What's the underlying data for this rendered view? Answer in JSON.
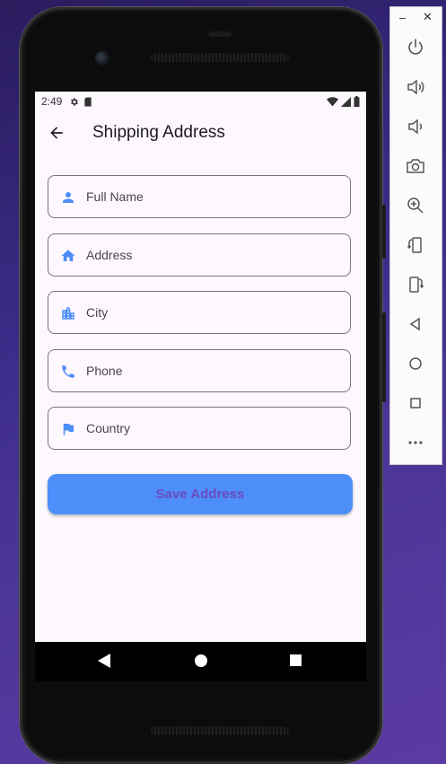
{
  "status_bar": {
    "time": "2:49"
  },
  "app_bar": {
    "title": "Shipping Address"
  },
  "form": {
    "fields": [
      {
        "placeholder": "Full Name",
        "icon": "person-icon"
      },
      {
        "placeholder": "Address",
        "icon": "home-icon"
      },
      {
        "placeholder": "City",
        "icon": "city-icon"
      },
      {
        "placeholder": "Phone",
        "icon": "phone-icon"
      },
      {
        "placeholder": "Country",
        "icon": "flag-icon"
      }
    ],
    "save_label": "Save Address"
  },
  "colors": {
    "accent": "#4e8ef8",
    "button_text": "#6a4cbf",
    "screen_bg": "#fdf7fe",
    "icon": "#4e8ef8"
  },
  "emulator_toolbar": {
    "window_controls": [
      "minimize-icon",
      "close-icon"
    ],
    "buttons": [
      "power-icon",
      "volume-up-icon",
      "volume-down-icon",
      "camera-icon",
      "zoom-icon",
      "rotate-left-icon",
      "rotate-right-icon",
      "back-icon",
      "home-icon",
      "overview-icon",
      "more-icon"
    ]
  },
  "nav_bar": {
    "buttons": [
      "back-icon",
      "home-icon",
      "recents-icon"
    ]
  }
}
